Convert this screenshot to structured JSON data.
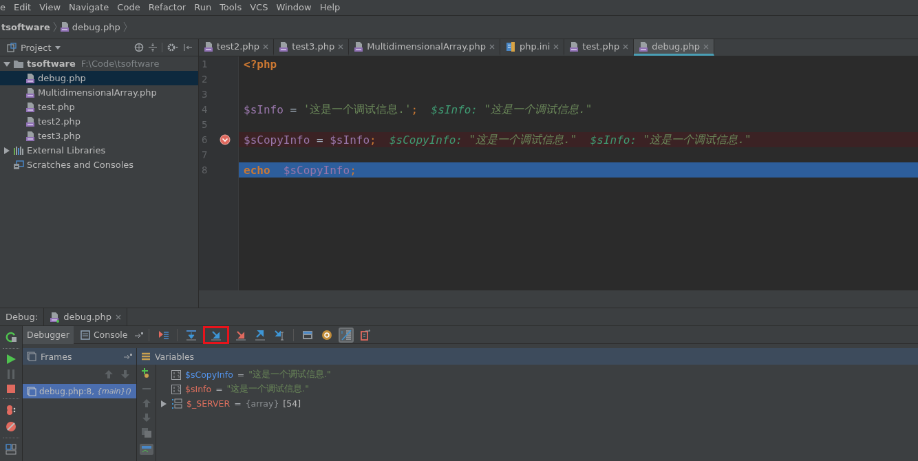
{
  "menu": [
    {
      "label": "e"
    },
    {
      "label": "Edit"
    },
    {
      "label": "View"
    },
    {
      "label": "Navigate"
    },
    {
      "label": "Code"
    },
    {
      "label": "Refactor"
    },
    {
      "label": "Run"
    },
    {
      "label": "Tools"
    },
    {
      "label": "VCS"
    },
    {
      "label": "Window"
    },
    {
      "label": "Help"
    }
  ],
  "breadcrumb": [
    {
      "label": "tsoftware",
      "kind": "project"
    },
    {
      "label": "debug.php",
      "kind": "php"
    }
  ],
  "project_panel": {
    "title": "Project",
    "tree": [
      {
        "label": "tsoftware",
        "path": "F:\\Code\\tsoftware",
        "kind": "folder",
        "expanded": true,
        "selected": false,
        "children": [
          {
            "label": "debug.php",
            "kind": "php",
            "selected": true
          },
          {
            "label": "MultidimensionalArray.php",
            "kind": "php",
            "selected": false
          },
          {
            "label": "test.php",
            "kind": "php",
            "selected": false
          },
          {
            "label": "test2.php",
            "kind": "php",
            "selected": false
          },
          {
            "label": "test3.php",
            "kind": "php",
            "selected": false
          }
        ]
      },
      {
        "label": "External Libraries",
        "kind": "libraries",
        "expanded": false,
        "selected": false
      },
      {
        "label": "Scratches and Consoles",
        "kind": "scratches",
        "selected": false
      }
    ]
  },
  "editor_tabs": [
    {
      "label": "test2.php",
      "kind": "php",
      "selected": false
    },
    {
      "label": "test3.php",
      "kind": "php",
      "selected": false
    },
    {
      "label": "MultidimensionalArray.php",
      "kind": "php",
      "selected": false
    },
    {
      "label": "php.ini",
      "kind": "ini",
      "selected": false
    },
    {
      "label": "test.php",
      "kind": "php",
      "selected": false
    },
    {
      "label": "debug.php",
      "kind": "php",
      "selected": true
    }
  ],
  "editor": {
    "lines": [
      {
        "number": "1",
        "breakpoint": false,
        "current": false,
        "tokens": [
          {
            "text": "<?php",
            "kind": "keyword"
          }
        ]
      },
      {
        "number": "2",
        "breakpoint": false,
        "current": false
      },
      {
        "number": "3",
        "breakpoint": false,
        "current": false
      },
      {
        "number": "4",
        "breakpoint": false,
        "current": false,
        "tokens": [
          {
            "text": "$sInfo",
            "kind": "var"
          },
          {
            "text": " = ",
            "kind": "op"
          },
          {
            "text": "'这是一个调试信息.'",
            "kind": "string"
          },
          {
            "text": ";",
            "kind": "punct"
          },
          {
            "text": "  $sInfo:",
            "kind": "hint_name"
          },
          {
            "text": " \"这是一个调试信息.\"",
            "kind": "hint_value"
          }
        ]
      },
      {
        "number": "5",
        "breakpoint": false,
        "current": false
      },
      {
        "number": "6",
        "breakpoint": true,
        "current": false,
        "tokens": [
          {
            "text": "$sCopyInfo",
            "kind": "var"
          },
          {
            "text": " = ",
            "kind": "op"
          },
          {
            "text": "$sInfo",
            "kind": "var"
          },
          {
            "text": ";",
            "kind": "punct"
          },
          {
            "text": "  $sCopyInfo:",
            "kind": "hint_name"
          },
          {
            "text": " \"这是一个调试信息.\"",
            "kind": "hint_value"
          },
          {
            "text": "  $sInfo:",
            "kind": "hint_name"
          },
          {
            "text": " \"这是一个调试信息.\"",
            "kind": "hint_value"
          }
        ]
      },
      {
        "number": "7",
        "breakpoint": false,
        "current": false
      },
      {
        "number": "8",
        "breakpoint": false,
        "current": true,
        "tokens": [
          {
            "text": "echo",
            "kind": "keyword"
          },
          {
            "text": "$sCopyInfo",
            "kind": "var"
          },
          {
            "text": ";",
            "kind": "punct"
          }
        ]
      }
    ]
  },
  "debug": {
    "label": "Debug:",
    "session_tab": "debug.php",
    "tabs": [
      {
        "label": "Debugger",
        "selected": true
      },
      {
        "label": "Console",
        "selected": false
      }
    ],
    "toolbar": [
      {
        "kind": "show-execution-point",
        "highlighted": false,
        "on": false
      },
      {
        "kind": "step-over",
        "highlighted": false,
        "on": false
      },
      {
        "kind": "step-into",
        "highlighted": true,
        "on": false
      },
      {
        "kind": "force-step-into",
        "highlighted": false,
        "on": false
      },
      {
        "kind": "step-out",
        "highlighted": false,
        "on": false
      },
      {
        "kind": "run-to-cursor",
        "highlighted": false,
        "on": false
      },
      {
        "kind": "evaluate",
        "highlighted": false,
        "on": false
      },
      {
        "kind": "watch",
        "highlighted": false,
        "on": false
      },
      {
        "kind": "show-values",
        "highlighted": false,
        "on": true
      },
      {
        "kind": "restore",
        "highlighted": false,
        "on": false
      }
    ],
    "frames": {
      "title": "Frames",
      "items": [
        {
          "label": "debug.php:8,",
          "detail": "{main}()",
          "selected": true
        }
      ]
    },
    "variables": {
      "title": "Variables",
      "items": [
        {
          "name": "$sCopyInfo",
          "color": "#5394ec",
          "kind": "string",
          "operator": "=",
          "value": "\"这是一个调试信息.\""
        },
        {
          "name": "$sInfo",
          "color": "#e0705e",
          "kind": "string",
          "operator": "=",
          "value": "\"这是一个调试信息.\""
        },
        {
          "name": "$_SERVER",
          "color": "#e0705e",
          "kind": "array",
          "operator": "=",
          "type": "{array}",
          "count": "[54]",
          "expanded": false
        }
      ]
    }
  }
}
